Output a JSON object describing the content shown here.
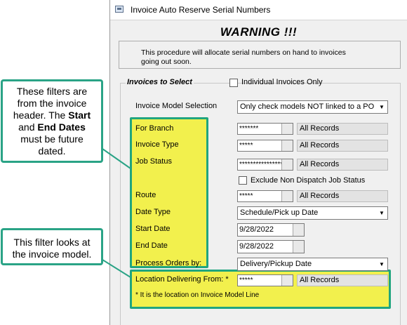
{
  "window": {
    "title": "Invoice Auto Reserve Serial Numbers",
    "warning": "WARNING !!!",
    "message_line1": "This procedure will allocate serial numbers on hand to invoices",
    "message_line2": "going out soon."
  },
  "group": {
    "label": "Invoices to Select",
    "individual_only_label": "Individual Invoices Only",
    "individual_only_checked": false
  },
  "fields": {
    "model_selection": {
      "label": "Invoice Model Selection",
      "value": "Only check models NOT linked to a PO"
    },
    "branch": {
      "label": "For Branch",
      "value": "*******",
      "records": "All Records"
    },
    "invoice_type": {
      "label": "Invoice Type",
      "value": "*****",
      "records": "All Records"
    },
    "job_status": {
      "label": "Job Status",
      "value": "****************",
      "records": "All Records"
    },
    "exclude_non_dispatch": {
      "label": "Exclude Non Dispatch Job Status",
      "checked": false
    },
    "route": {
      "label": "Route",
      "value": "*****",
      "records": "All Records"
    },
    "date_type": {
      "label": "Date Type",
      "value": "Schedule/Pick up Date"
    },
    "start_date": {
      "label": "Start Date",
      "value": "9/28/2022"
    },
    "end_date": {
      "label": "End Date",
      "value": "9/28/2022"
    },
    "process_orders_by": {
      "label": "Process Orders by:",
      "value": "Delivery/Pickup Date"
    },
    "location_delivering_from": {
      "label": "Location Delivering From: *",
      "value": "*****",
      "records": "All Records"
    },
    "location_note": "* It is the location on Invoice Model Line"
  },
  "callouts": {
    "header_filters": {
      "line1": "These filters are",
      "line2": "from the invoice",
      "line3_prefix": "header. The ",
      "start_bold": "Start",
      "line4_prefix": "and ",
      "end_bold": "End Dates",
      "line5": "must be future",
      "line6": "dated."
    },
    "model_filter": {
      "line1": "This filter looks at",
      "line2": "the invoice model."
    }
  },
  "colors": {
    "highlight": "#f2f04d",
    "callout_border": "#2aa386"
  }
}
